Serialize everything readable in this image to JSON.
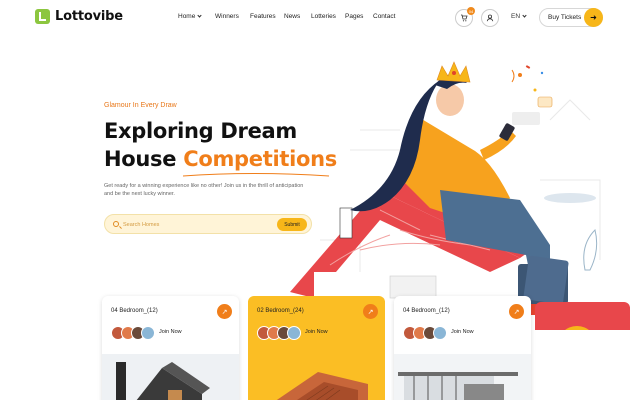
{
  "brand": {
    "name": "Lottovibe"
  },
  "nav": {
    "items": [
      {
        "label": "Home",
        "has_dropdown": true
      },
      {
        "label": "Winners"
      },
      {
        "label": "Features"
      },
      {
        "label": "News"
      },
      {
        "label": "Lotteries"
      },
      {
        "label": "Pages"
      },
      {
        "label": "Contact"
      }
    ]
  },
  "header": {
    "cart_count": "04",
    "language": "EN",
    "buy_label": "Buy Tickets"
  },
  "hero": {
    "tagline": "Glamour In Every Draw",
    "title_line1": "Exploring Dream",
    "title_line2": "House",
    "title_accent": "Competitions",
    "description": "Get ready for a winning experience like no other! Join us in the thrill of anticipation and be the next lucky winner.",
    "search_placeholder": "Search Homes",
    "submit_label": "Submit"
  },
  "cards": [
    {
      "title": "04 Bedroom_(12)",
      "join_label": "Join Now"
    },
    {
      "title": "02 Bedroom_(24)",
      "join_label": "Join Now"
    },
    {
      "title": "04 Bedroom_(12)",
      "join_label": "Join Now"
    }
  ],
  "colors": {
    "accent_orange": "#f07e1a",
    "accent_yellow": "#fbbe24",
    "logo_green": "#8cc63f"
  }
}
